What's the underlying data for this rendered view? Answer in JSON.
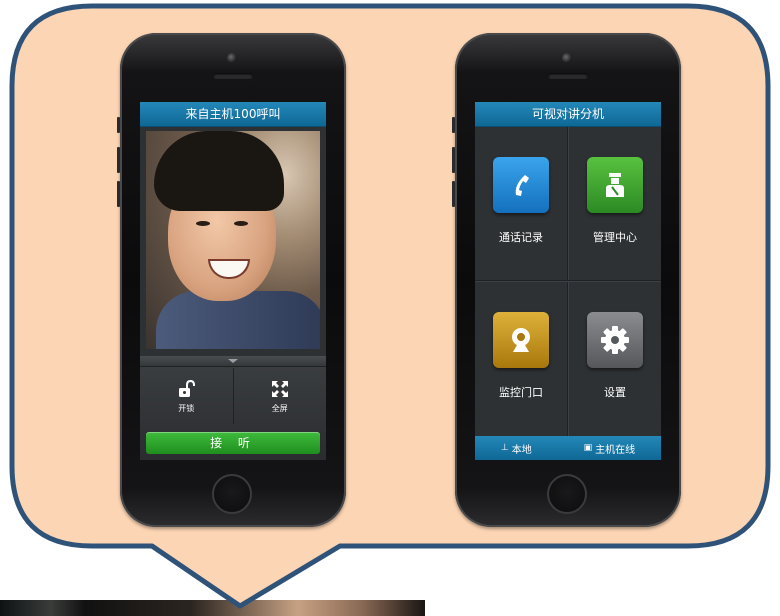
{
  "left_phone": {
    "title": "来自主机100呼叫",
    "controls": [
      {
        "label": "开锁",
        "icon": "unlock-icon"
      },
      {
        "label": "全屏",
        "icon": "fullscreen-icon"
      }
    ],
    "answer_label": "接 听"
  },
  "right_phone": {
    "title": "可视对讲分机",
    "tiles": [
      {
        "label": "通话记录",
        "icon": "phone-icon",
        "color": "#1e88d6"
      },
      {
        "label": "管理中心",
        "icon": "guard-icon",
        "color": "#3ea82f"
      },
      {
        "label": "监控门口",
        "icon": "webcam-icon",
        "color": "#c89112"
      },
      {
        "label": "设置",
        "icon": "gear-icon",
        "color": "#6d6f72"
      }
    ],
    "status": {
      "local_label": "本地",
      "host_label": "主机在线"
    }
  },
  "colors": {
    "bubble_fill": "#fcd5b4",
    "bubble_stroke": "#2f5378",
    "title_bar": "#1b7db0",
    "answer_green": "#2aa52a"
  }
}
